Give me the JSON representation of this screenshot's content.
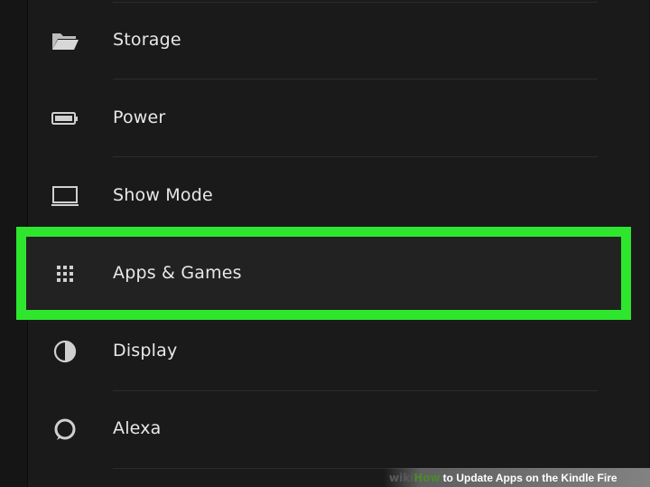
{
  "settings": {
    "items": [
      {
        "label": "Storage",
        "icon": "folder-icon"
      },
      {
        "label": "Power",
        "icon": "battery-icon"
      },
      {
        "label": "Show Mode",
        "icon": "monitor-icon"
      },
      {
        "label": "Apps & Games",
        "icon": "apps-grid-icon",
        "highlighted": true
      },
      {
        "label": "Display",
        "icon": "contrast-icon"
      },
      {
        "label": "Alexa",
        "icon": "alexa-ring-icon"
      }
    ]
  },
  "highlight_color": "#2fe62f",
  "watermark": {
    "brand_wiki": "wiki",
    "brand_how": "How",
    "title": "to Update Apps on the Kindle Fire"
  }
}
